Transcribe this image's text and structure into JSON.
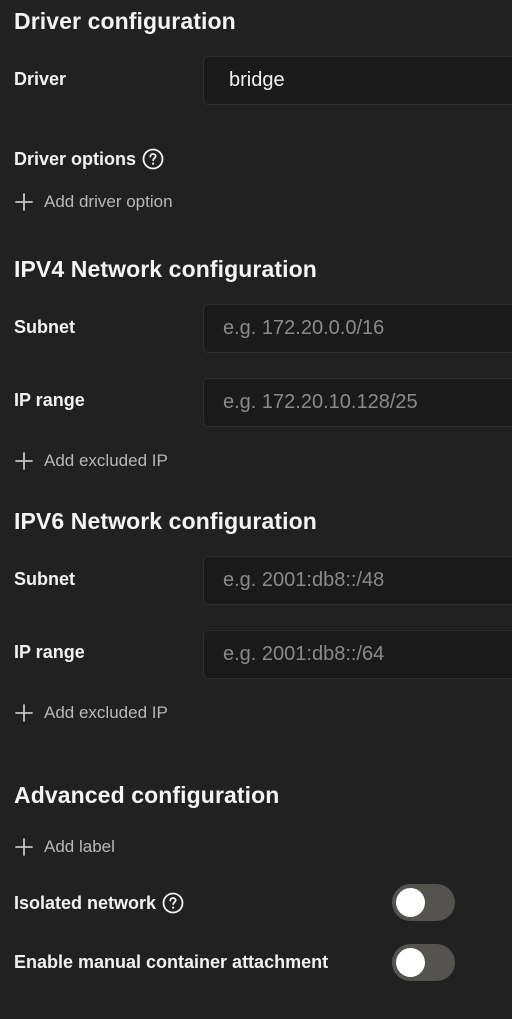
{
  "driver_config": {
    "title": "Driver configuration",
    "driver_label": "Driver",
    "driver_value": "bridge",
    "options_label": "Driver options",
    "add_option": "Add driver option"
  },
  "ipv4": {
    "title": "IPV4 Network configuration",
    "subnet_label": "Subnet",
    "subnet_placeholder": "e.g. 172.20.0.0/16",
    "ip_range_label": "IP range",
    "ip_range_placeholder": "e.g. 172.20.10.128/25",
    "add_excluded": "Add excluded IP"
  },
  "ipv6": {
    "title": "IPV6 Network configuration",
    "subnet_label": "Subnet",
    "subnet_placeholder": "e.g. 2001:db8::/48",
    "ip_range_label": "IP range",
    "ip_range_placeholder": "e.g. 2001:db8::/64",
    "add_excluded": "Add excluded IP"
  },
  "advanced": {
    "title": "Advanced configuration",
    "add_label": "Add label",
    "isolated_label": "Isolated network",
    "isolated_on": false,
    "manual_attach_label": "Enable manual container attachment",
    "manual_attach_on": false
  },
  "colors": {
    "background": "#212121",
    "input_bg": "#1a1a1a",
    "toggle_off": "#555350"
  }
}
